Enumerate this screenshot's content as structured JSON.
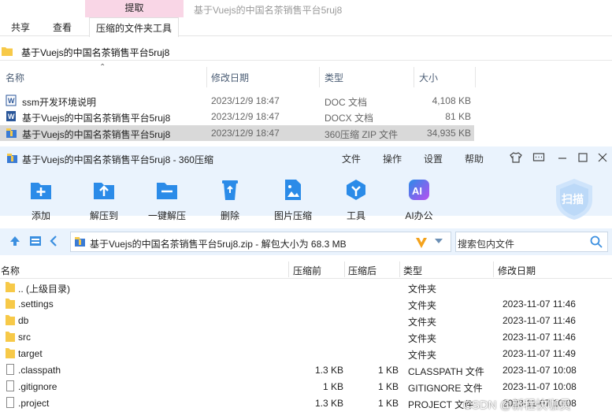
{
  "ribbon": {
    "context_tab": "提取",
    "window_title": "基于Vuejs的中国名茶销售平台5ruj8",
    "tabs": [
      "共享",
      "查看",
      "压缩的文件夹工具"
    ]
  },
  "address": {
    "path": "基于Vuejs的中国名茶销售平台5ruj8"
  },
  "explorer": {
    "columns": [
      "名称",
      "修改日期",
      "类型",
      "大小"
    ],
    "rows": [
      {
        "name": "ssm开发环境说明",
        "date": "2023/12/9 18:47",
        "type": "DOC 文档",
        "size": "4,108 KB"
      },
      {
        "name": "基于Vuejs的中国名茶销售平台5ruj8",
        "date": "2023/12/9 18:47",
        "type": "DOCX 文档",
        "size": "81 KB"
      },
      {
        "name": "基于Vuejs的中国名茶销售平台5ruj8",
        "date": "2023/12/9 18:47",
        "type": "360压缩 ZIP 文件",
        "size": "34,935 KB"
      }
    ]
  },
  "zip": {
    "title": "基于Vuejs的中国名茶销售平台5ruj8 - 360压缩",
    "menu": [
      "文件",
      "操作",
      "设置",
      "帮助"
    ],
    "toolbar": [
      "添加",
      "解压到",
      "一键解压",
      "删除",
      "图片压缩",
      "工具",
      "AI办公"
    ],
    "scan_label": "扫描",
    "path": "基于Vuejs的中国名茶销售平台5ruj8.zip - 解包大小为 68.3 MB",
    "search_placeholder": "搜索包内文件",
    "columns": [
      "名称",
      "压缩前",
      "压缩后",
      "类型",
      "修改日期"
    ],
    "rows": [
      {
        "name": ".. (上级目录)",
        "before": "",
        "after": "",
        "type": "文件夹",
        "date": "",
        "kind": "folder"
      },
      {
        "name": ".settings",
        "before": "",
        "after": "",
        "type": "文件夹",
        "date": "2023-11-07 11:46",
        "kind": "folder"
      },
      {
        "name": "db",
        "before": "",
        "after": "",
        "type": "文件夹",
        "date": "2023-11-07 11:46",
        "kind": "folder"
      },
      {
        "name": "src",
        "before": "",
        "after": "",
        "type": "文件夹",
        "date": "2023-11-07 11:46",
        "kind": "folder"
      },
      {
        "name": "target",
        "before": "",
        "after": "",
        "type": "文件夹",
        "date": "2023-11-07 11:49",
        "kind": "folder"
      },
      {
        "name": ".classpath",
        "before": "1.3 KB",
        "after": "1 KB",
        "type": "CLASSPATH 文件",
        "date": "2023-11-07 10:08",
        "kind": "file"
      },
      {
        "name": ".gitignore",
        "before": "1 KB",
        "after": "1 KB",
        "type": "GITIGNORE 文件",
        "date": "2023-11-07 10:08",
        "kind": "file"
      },
      {
        "name": ".project",
        "before": "1.3 KB",
        "after": "1 KB",
        "type": "PROJECT 文件",
        "date": "2023-11-07 10:08",
        "kind": "file"
      }
    ]
  },
  "watermark": "CSDN @新程快咖员",
  "colors": {
    "accent": "#2b8be8",
    "folder": "#f7c948",
    "selection": "#d9d9d9",
    "toolbar_bg": "#eaf3fd"
  }
}
